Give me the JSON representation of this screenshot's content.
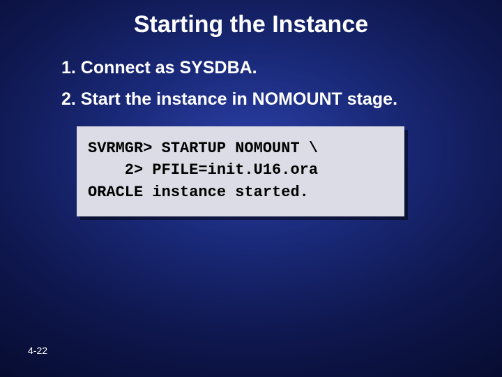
{
  "slide": {
    "title": "Starting the Instance",
    "items": [
      "1. Connect as SYSDBA.",
      "2. Start the instance in NOMOUNT stage."
    ],
    "code": "SVRMGR> STARTUP NOMOUNT \\\n    2> PFILE=init.U16.ora\nORACLE instance started.",
    "page": "4-22"
  }
}
